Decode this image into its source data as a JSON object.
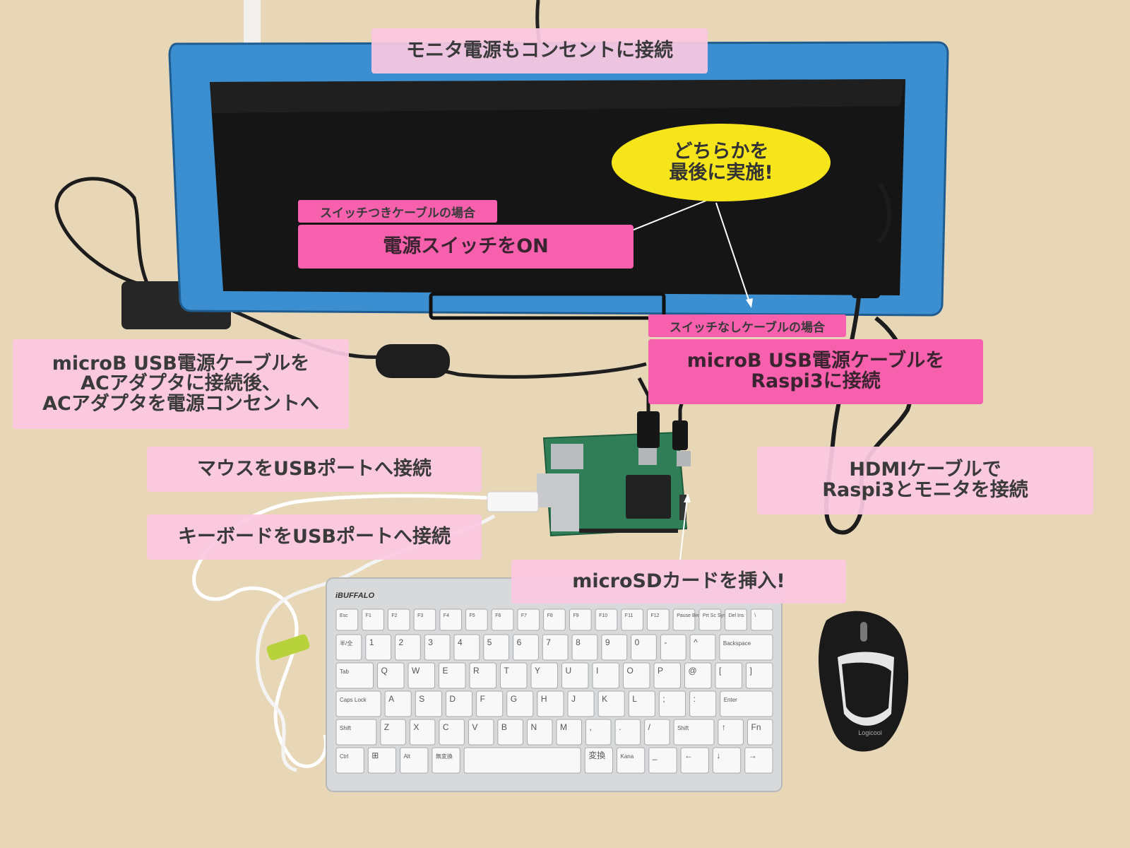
{
  "labels": {
    "monitor_power": "モニタ電源もコンセントに接続",
    "power_switch_on": "電源スイッチをON",
    "switch_cable_case": "スイッチつきケーブルの場合",
    "no_switch_cable_case": "スイッチなしケーブルの場合",
    "microb_to_raspi": "microB USB電源ケーブルを\nRaspi3に接続",
    "microb_to_adapter": "microB USB電源ケーブルを\nACアダプタに接続後、\nACアダプタを電源コンセントへ",
    "mouse_usb": "マウスをUSBポートへ接続",
    "keyboard_usb": "キーボードをUSBポートへ接続",
    "hdmi": "HDMIケーブルで\nRaspi3とモニタを接続",
    "microsd": "microSDカードを挿入!"
  },
  "callout": {
    "line1": "どちらかを",
    "line2": "最後に実施!"
  },
  "photo_text": {
    "keyboard_brand": "iBUFFALO",
    "mouse_brand": "Logicool",
    "key_rows": [
      [
        "Esc",
        "F1",
        "F2",
        "F3",
        "F4",
        "F5",
        "F6",
        "F7",
        "F8",
        "F9",
        "F10",
        "F11",
        "F12",
        "Pause Break",
        "Prt Sc SysRq",
        "Del Ins",
        "\\"
      ],
      [
        "半/全",
        "1",
        "2",
        "3",
        "4",
        "5",
        "6",
        "7",
        "8",
        "9",
        "0",
        "-",
        "^",
        "Backspace"
      ],
      [
        "Tab",
        "Q",
        "W",
        "E",
        "R",
        "T",
        "Y",
        "U",
        "I",
        "O",
        "P",
        "@",
        "[",
        "]"
      ],
      [
        "Caps Lock",
        "A",
        "S",
        "D",
        "F",
        "G",
        "H",
        "J",
        "K",
        "L",
        ";",
        ":",
        "Enter"
      ],
      [
        "Shift",
        "Z",
        "X",
        "C",
        "V",
        "B",
        "N",
        "M",
        ",",
        ".",
        "/",
        "Shift",
        "↑",
        "Fn"
      ],
      [
        "Ctrl",
        "⊞",
        "Alt",
        "無変換",
        "",
        "変換",
        "Kana",
        "_",
        "←",
        "↓",
        "→"
      ]
    ]
  },
  "colors": {
    "desk": "#e8d6b6",
    "monitor_frame": "#3b8fd0",
    "label_light_pink": "#fbc8e1",
    "label_hot_pink": "#f760ad",
    "callout_yellow": "#f7e51c"
  }
}
